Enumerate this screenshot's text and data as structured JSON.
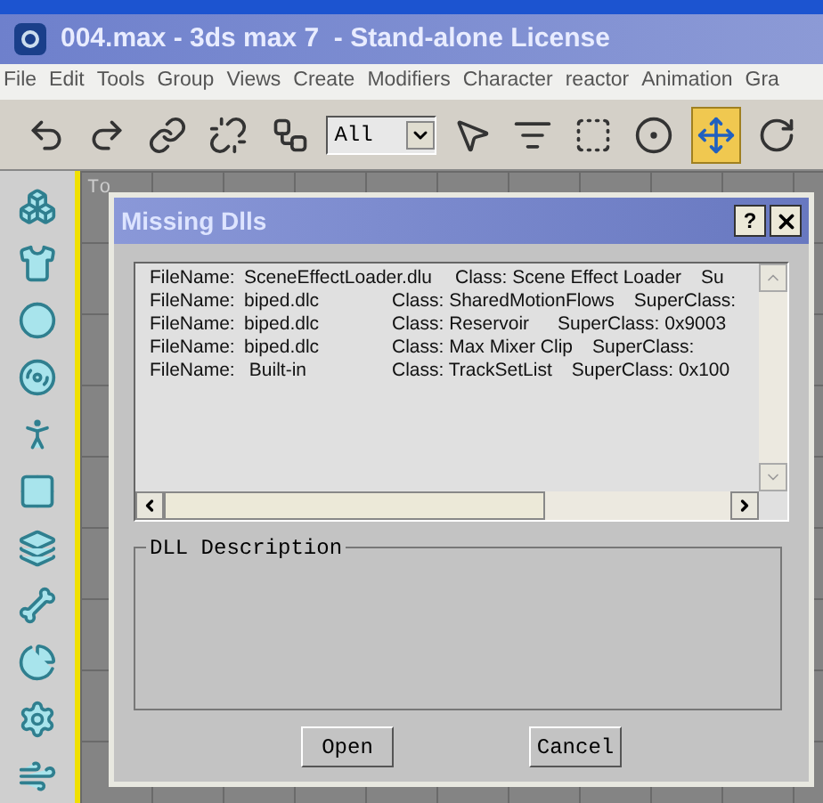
{
  "window": {
    "title": "004.max - 3ds max 7  - Stand-alone License"
  },
  "menu": [
    "File",
    "Edit",
    "Tools",
    "Group",
    "Views",
    "Create",
    "Modifiers",
    "Character",
    "reactor",
    "Animation",
    "Gra"
  ],
  "toolbar": {
    "tools": [
      {
        "kind": "undo",
        "selected": false
      },
      {
        "kind": "redo",
        "selected": false
      },
      {
        "kind": "link",
        "selected": false
      },
      {
        "kind": "unlink",
        "selected": false
      },
      {
        "kind": "bind",
        "selected": false
      },
      {
        "kind": "filter",
        "value": "All"
      },
      {
        "kind": "pointer",
        "selected": false
      },
      {
        "kind": "select-list",
        "selected": false
      },
      {
        "kind": "region",
        "selected": false
      },
      {
        "kind": "window",
        "selected": false
      },
      {
        "kind": "move",
        "selected": true
      },
      {
        "kind": "rotate",
        "selected": false
      }
    ]
  },
  "sidebar": {
    "tools": [
      {
        "kind": "boxes"
      },
      {
        "kind": "shirt"
      },
      {
        "kind": "ball"
      },
      {
        "kind": "top"
      },
      {
        "kind": "figure"
      },
      {
        "kind": "checker"
      },
      {
        "kind": "spring"
      },
      {
        "kind": "bone"
      },
      {
        "kind": "bones"
      },
      {
        "kind": "gear"
      },
      {
        "kind": "vane"
      }
    ]
  },
  "viewport": {
    "label": "To"
  },
  "dialog": {
    "title": "Missing Dlls",
    "help": "?",
    "rows": [
      {
        "label": "FileName:",
        "file": "SceneEffectLoader.dlu",
        "class": "Class: Scene Effect Loader",
        "superclass": "Su"
      },
      {
        "label": "FileName:",
        "file": "biped.dlc",
        "class": "Class: SharedMotionFlows",
        "superclass": "SuperClass:"
      },
      {
        "label": "FileName:",
        "file": "biped.dlc",
        "class": "Class: Reservoir",
        "superclass": "SuperClass: 0x9003"
      },
      {
        "label": "FileName:",
        "file": "biped.dlc",
        "class": "Class: Max Mixer Clip",
        "superclass": "SuperClass:"
      },
      {
        "label": "FileName:",
        "file": " Built-in",
        "class": "Class: TrackSetList",
        "superclass": "SuperClass: 0x100"
      }
    ],
    "description": {
      "title": "DLL Description"
    },
    "buttons": [
      "Open",
      "Cancel"
    ]
  }
}
